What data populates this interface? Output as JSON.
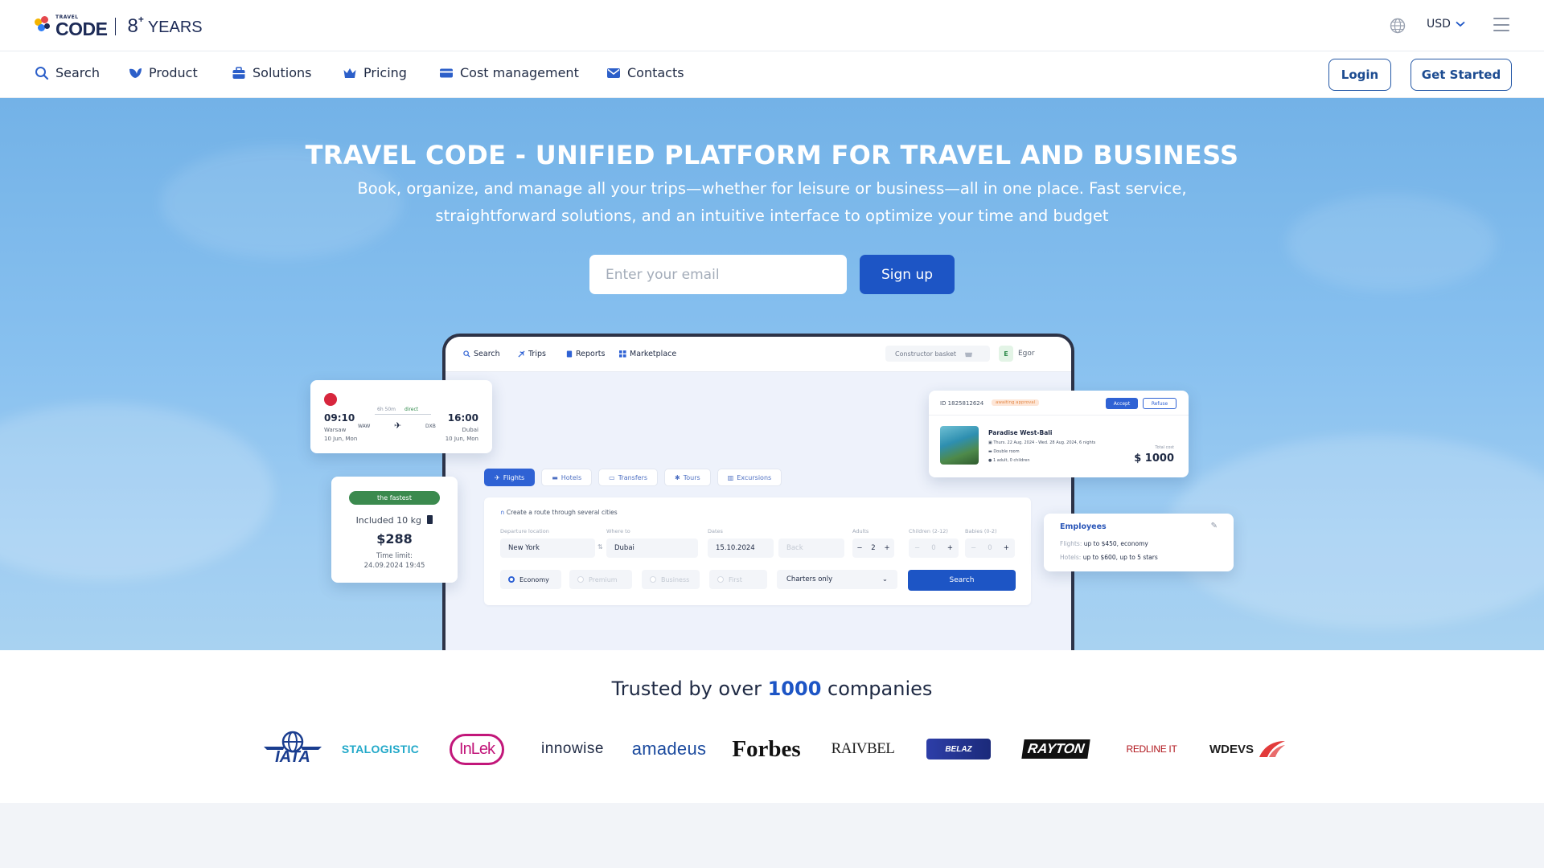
{
  "header": {
    "logo_small": "TRAVEL",
    "logo_big": "CODE",
    "years_number": "8",
    "years_plus": "+",
    "years_label": "YEARS",
    "currency": "USD"
  },
  "nav": {
    "items": [
      {
        "label": "Search",
        "icon": "search-icon"
      },
      {
        "label": "Product",
        "icon": "leaf-icon"
      },
      {
        "label": "Solutions",
        "icon": "briefcase-icon"
      },
      {
        "label": "Pricing",
        "icon": "crown-icon"
      },
      {
        "label": "Cost management",
        "icon": "card-icon"
      },
      {
        "label": "Contacts",
        "icon": "mail-icon"
      }
    ],
    "login_label": "Login",
    "get_started_label": "Get Started"
  },
  "hero": {
    "title": "TRAVEL CODE - UNIFIED PLATFORM FOR TRAVEL AND BUSINESS",
    "subtitle": "Book, organize, and manage all your trips—whether for leisure or business—all in one place. Fast service, straightforward solutions, and an intuitive interface to optimize your time and budget",
    "email_placeholder": "Enter your email",
    "signup_label": "Sign up"
  },
  "mockup": {
    "tabs": [
      "Search",
      "Trips",
      "Reports",
      "Marketplace"
    ],
    "basket": "Constructor basket",
    "avatar": "E",
    "user": "Egor",
    "segments": [
      "Flights",
      "Hotels",
      "Transfers",
      "Tours",
      "Excursions"
    ],
    "route_link": "Create a route through several cities",
    "labels": {
      "departure": "Departure location",
      "where": "Where to",
      "dates": "Dates",
      "adults": "Adults",
      "children": "Children (2-12)",
      "babies": "Babies (0-2)"
    },
    "from": "New York",
    "to": "Dubai",
    "date": "15.10.2024",
    "back": "Back",
    "adults": "2",
    "children": "0",
    "babies": "0",
    "classes": [
      "Economy",
      "Premium",
      "Business",
      "First"
    ],
    "charters": "Charters only",
    "search_label": "Search"
  },
  "flight_card": {
    "dep_time": "09:10",
    "dep_city": "Warsaw",
    "dep_date": "10 Jun, Mon",
    "arr_time": "16:00",
    "arr_city": "Dubai",
    "arr_date": "10 Jun, Mon",
    "duration": "6h 50m",
    "type": "direct",
    "from_code": "WAW",
    "to_code": "DXB"
  },
  "fare_card": {
    "badge": "the fastest",
    "baggage": "Included 10 kg",
    "price": "$288",
    "limit_label": "Time limit:",
    "limit_value": "24.09.2024 19:45"
  },
  "hotel_card": {
    "id": "ID 1825812624",
    "status": "awaiting approval",
    "accept": "Accept",
    "refuse": "Refuse",
    "name": "Paradise West-Bali",
    "dates": "Thurs. 22 Aug. 2024 - Wed. 28 Aug. 2024, 6 nights",
    "room": "Double room",
    "guests": "1 adult, 0 children",
    "total_label": "Total cost",
    "total": "$ 1000"
  },
  "employees_card": {
    "title": "Employees",
    "flights_label": "Flights:",
    "flights_value": "up to $450, economy",
    "hotels_label": "Hotels:",
    "hotels_value": "up to $600, up to 5 stars"
  },
  "trusted": {
    "prefix": "Trusted by over",
    "count": "1000",
    "suffix": "companies",
    "logos": [
      "IATA",
      "STALOGISTIC",
      "InLek",
      "innowise",
      "amadeus",
      "Forbes",
      "RAIVBEL",
      "BELAZ",
      "RAYTON",
      "REDLINE IT",
      "WDEVS"
    ]
  },
  "colors": {
    "primary": "#1d55c5",
    "navy": "#1d2b57",
    "hero_top": "#73b2e7",
    "hero_bottom": "#a8d2f1"
  }
}
